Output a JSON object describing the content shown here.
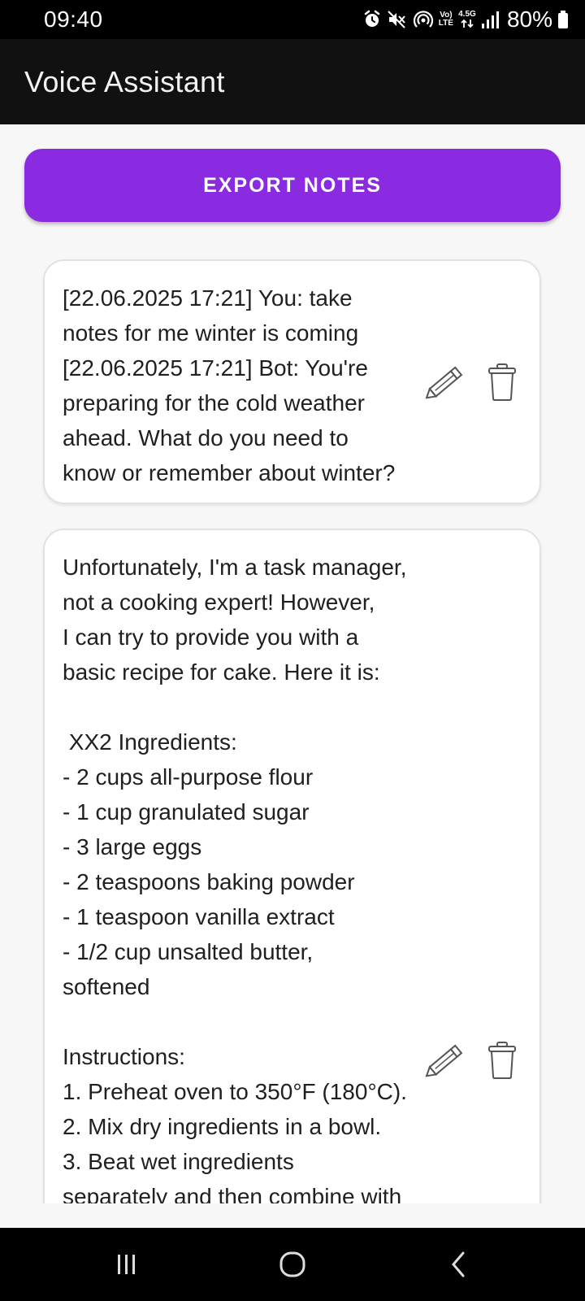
{
  "status_bar": {
    "time": "09:40",
    "network_label_top": "Vo)",
    "network_label_bottom": "LTE",
    "network_type": "4.5G",
    "battery": "80%",
    "icons": [
      "alarm-icon",
      "mute-icon",
      "hotspot-icon",
      "volte-icon",
      "data-arrows-icon",
      "signal-icon",
      "battery-icon"
    ]
  },
  "app_bar": {
    "title": "Voice Assistant"
  },
  "toolbar": {
    "export_label": "EXPORT NOTES"
  },
  "notes": [
    {
      "text": "[22.06.2025 17:21] You: take\nnotes for me winter is coming\n[22.06.2025 17:21] Bot: You're\npreparing for the cold weather\nahead. What do you need to\nknow or remember about winter?",
      "edit_icon": "pencil-icon",
      "delete_icon": "trash-icon"
    },
    {
      "text": "Unfortunately, I'm a task manager,\nnot a cooking expert! However,\nI can try to provide you with a\nbasic recipe for cake. Here it is:\n\n XX2 Ingredients:\n- 2 cups all-purpose flour\n- 1 cup granulated sugar\n- 3 large eggs\n- 2 teaspoons baking powder\n- 1 teaspoon vanilla extract\n- 1/2 cup unsalted butter,\nsoftened\n\nInstructions:\n1. Preheat oven to 350°F (180°C).\n2. Mix dry ingredients in a bowl.\n3. Beat wet ingredients\nseparately and then combine with",
      "edit_icon": "pencil-icon",
      "delete_icon": "trash-icon"
    }
  ],
  "nav_bar": {
    "icons": [
      "recent-apps-icon",
      "home-icon",
      "back-icon"
    ]
  },
  "colors": {
    "accent": "#8a2be2",
    "app_bar": "#111111",
    "background": "#f7f7f7",
    "card": "#ffffff"
  }
}
